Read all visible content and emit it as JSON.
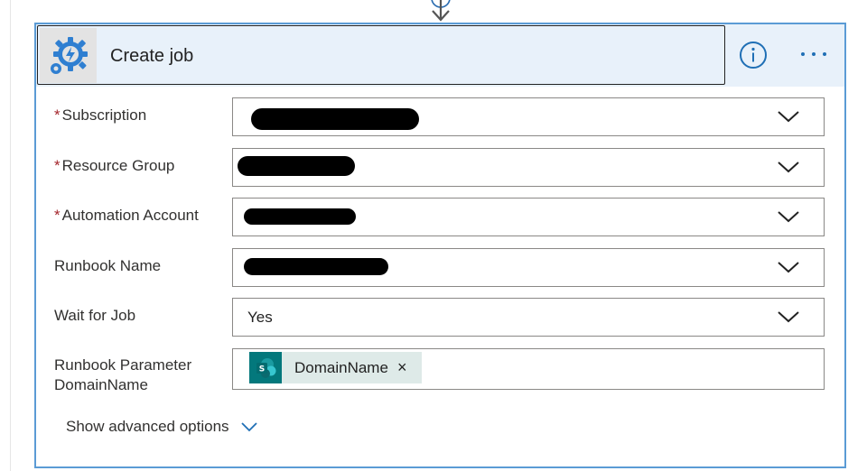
{
  "card": {
    "title": "Create job",
    "info_icon": "info-circle-icon",
    "more_icon": "ellipsis-icon",
    "app_icon": "automation-gear-icon"
  },
  "fields": {
    "subscription": {
      "label": "Subscription",
      "required": "*"
    },
    "resource_group": {
      "label": "Resource Group",
      "required": "*"
    },
    "automation_account": {
      "label": "Automation Account",
      "required": "*"
    },
    "runbook_name": {
      "label": "Runbook Name"
    },
    "wait_for_job": {
      "label": "Wait for Job",
      "value": "Yes"
    },
    "runbook_parameter": {
      "label_line1": "Runbook Parameter",
      "label_line2": "DomainName",
      "token": "DomainName",
      "token_remove": "×"
    }
  },
  "advanced": {
    "label": "Show advanced options"
  },
  "colors": {
    "accent": "#5b9bd5",
    "header_bg": "#e8f1fa",
    "required": "#a4262c",
    "token_bg": "#deeae8",
    "token_icon_bg": "#03787c"
  }
}
